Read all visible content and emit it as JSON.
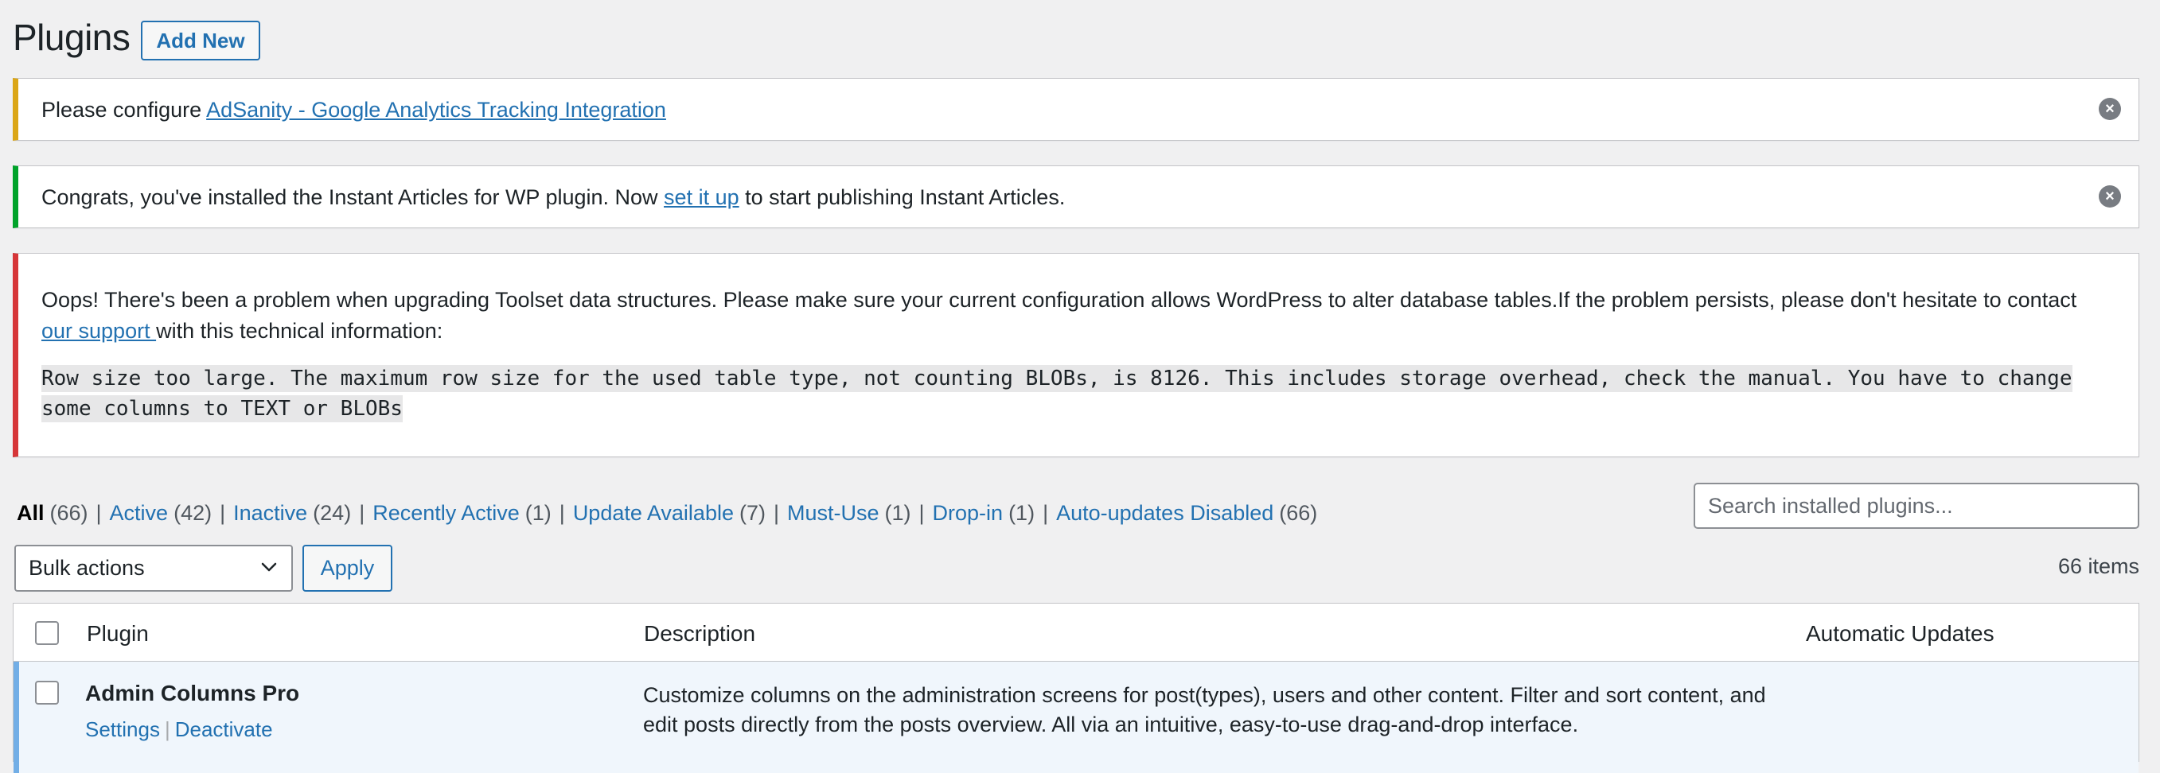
{
  "header": {
    "title": "Plugins",
    "add_new_label": "Add New"
  },
  "notices": {
    "warning": {
      "prefix": "Please configure ",
      "link": "AdSanity - Google Analytics Tracking Integration",
      "dismiss_icon": "dismiss-icon"
    },
    "success": {
      "prefix": "Congrats, you've installed the Instant Articles for WP plugin. Now ",
      "link": "set it up",
      "suffix": " to start publishing Instant Articles.",
      "dismiss_icon": "dismiss-icon"
    },
    "error": {
      "line1": "Oops! There's been a problem when upgrading Toolset data structures. Please make sure your current configuration allows WordPress to alter database tables.If the problem persists, please don't hesitate to contact",
      "support_link": "our support ",
      "line2_suffix": "with this technical information:",
      "code": " Row size too large. The maximum row size for the used table type, not counting BLOBs, is 8126. This includes storage overhead, check the manual. You have to change some columns to TEXT or BLOBs "
    }
  },
  "filters": [
    {
      "label": "All",
      "count": "(66)",
      "current": true
    },
    {
      "label": "Active",
      "count": "(42)"
    },
    {
      "label": "Inactive",
      "count": "(24)"
    },
    {
      "label": "Recently Active",
      "count": "(1)"
    },
    {
      "label": "Update Available",
      "count": "(7)"
    },
    {
      "label": "Must-Use",
      "count": "(1)"
    },
    {
      "label": "Drop-in",
      "count": "(1)"
    },
    {
      "label": "Auto-updates Disabled",
      "count": "(66)"
    }
  ],
  "filter_separator": "|",
  "search": {
    "placeholder": "Search installed plugins..."
  },
  "bulk": {
    "selected": "Bulk actions",
    "apply_label": "Apply",
    "items_count": "66 items"
  },
  "table": {
    "columns": {
      "plugin": "Plugin",
      "description": "Description",
      "auto_updates": "Automatic Updates"
    },
    "rows": [
      {
        "name": "Admin Columns Pro",
        "actions": [
          "Settings",
          "Deactivate"
        ],
        "description": "Customize columns on the administration screens for post(types), users and other content. Filter and sort content, and edit posts directly from the posts overview. All via an intuitive, easy-to-use drag-and-drop interface."
      }
    ]
  },
  "colors": {
    "link": "#2271b1",
    "warning_border": "#dba617",
    "success_border": "#00a32a",
    "error_border": "#d63638",
    "active_row_bg": "#f0f6fc",
    "active_row_border": "#72aee6"
  }
}
